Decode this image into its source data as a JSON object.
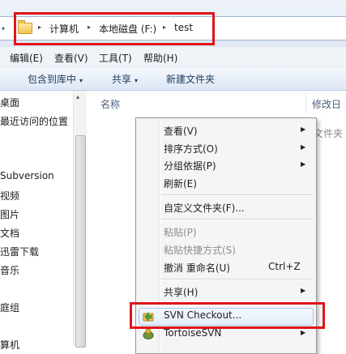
{
  "address_bar": {
    "breadcrumbs": [
      "计算机",
      "本地磁盘 (F:)",
      "test"
    ],
    "separator": "▸",
    "nav_dropdown": "▾"
  },
  "menu_bar": {
    "items": [
      "编辑(E)",
      "查看(V)",
      "工具(T)",
      "帮助(H)"
    ]
  },
  "toolbar": {
    "buttons": [
      "包含到库中",
      "共享",
      "新建文件夹"
    ],
    "dropdown_arrow": "▾"
  },
  "nav_pane": {
    "items": [
      "桌面",
      "最近访问的位置",
      "",
      "Subversion",
      "视频",
      "图片",
      "文档",
      "迅雷下载",
      "音乐",
      "",
      "庭组",
      "",
      "算机"
    ],
    "scroll_up": "▴"
  },
  "content": {
    "columns": [
      "名称",
      "修改日"
    ],
    "behind_text": "文件夹"
  },
  "context_menu": {
    "items": [
      {
        "label": "查看(V)",
        "submenu": true,
        "disabled": false
      },
      {
        "label": "排序方式(O)",
        "submenu": true,
        "disabled": false
      },
      {
        "label": "分组依据(P)",
        "submenu": true,
        "disabled": false
      },
      {
        "label": "刷新(E)",
        "submenu": false,
        "disabled": false
      },
      {
        "label": "自定义文件夹(F)...",
        "submenu": false,
        "disabled": false
      },
      {
        "label": "粘贴(P)",
        "submenu": false,
        "disabled": true
      },
      {
        "label": "粘贴快捷方式(S)",
        "submenu": false,
        "disabled": true
      },
      {
        "label": "撤消 重命名(U)",
        "submenu": false,
        "disabled": false,
        "shortcut": "Ctrl+Z"
      },
      {
        "label": "共享(H)",
        "submenu": true,
        "disabled": false
      },
      {
        "label": "SVN Checkout...",
        "submenu": false,
        "disabled": false,
        "highlighted": true,
        "icon": "svn-checkout-icon"
      },
      {
        "label": "TortoiseSVN",
        "submenu": true,
        "disabled": false,
        "icon": "tortoisesvn-icon"
      }
    ],
    "submenu_arrow": "▶"
  },
  "colors": {
    "annotation_red": "#e0141a",
    "hover_border": "#a8c6ec",
    "disabled_text": "#8d8d8d"
  }
}
